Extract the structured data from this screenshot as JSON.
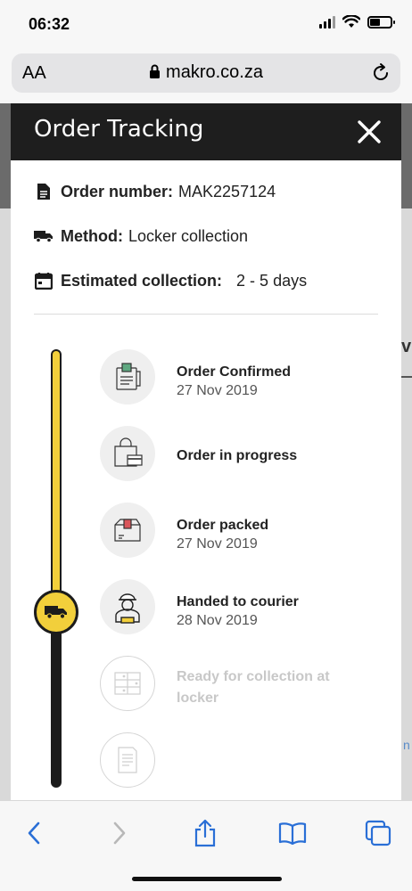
{
  "status_bar": {
    "time": "06:32"
  },
  "browser": {
    "aa_label": "AA",
    "url": "makro.co.za"
  },
  "modal": {
    "title": "Order Tracking",
    "order_number_label": "Order number:",
    "order_number": "MAK2257124",
    "method_label": "Method:",
    "method": "Locker collection",
    "estimated_label": "Estimated collection:",
    "estimated": "2 - 5 days"
  },
  "timeline": {
    "progress_fraction": 0.59,
    "steps": [
      {
        "title": "Order Confirmed",
        "date": "27 Nov 2019",
        "icon": "receipt-icon",
        "done": true
      },
      {
        "title": "Order in progress",
        "date": "",
        "icon": "shopping-bag-card-icon",
        "done": true
      },
      {
        "title": "Order packed",
        "date": "27 Nov 2019",
        "icon": "package-box-icon",
        "done": true
      },
      {
        "title": "Handed to courier",
        "date": "28 Nov 2019",
        "icon": "courier-person-icon",
        "done": true
      },
      {
        "title": "Ready for collection at locker",
        "date": "",
        "icon": "locker-icon",
        "done": false
      },
      {
        "title": "",
        "date": "",
        "icon": "receipt-pending-icon",
        "done": false
      }
    ]
  },
  "background_page": {
    "peek_letter": "v",
    "peek_letter_bottom": "n"
  },
  "colors": {
    "accent_yellow": "#f2cf3b",
    "header_dark": "#1e1e1e",
    "ios_blue": "#2a6fd6"
  }
}
